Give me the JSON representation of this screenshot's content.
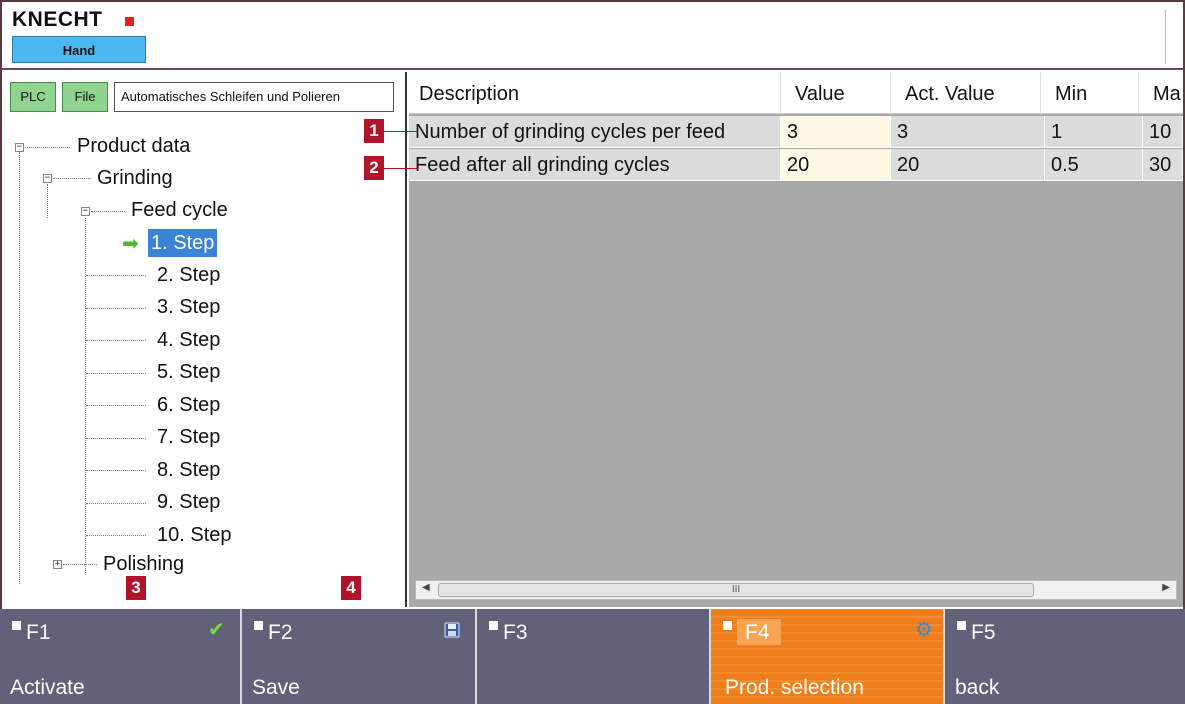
{
  "header": {
    "logo": "KNECHT",
    "mode": "Hand"
  },
  "toolbar": {
    "plc_label": "PLC",
    "file_label": "File",
    "program_name": "Automatisches Schleifen und Polieren"
  },
  "tree": {
    "root": "Product data",
    "grinding": "Grinding",
    "feed_cycle": "Feed cycle",
    "steps": [
      "1. Step",
      "2. Step",
      "3. Step",
      "4. Step",
      "5. Step",
      "6. Step",
      "7. Step",
      "8. Step",
      "9. Step",
      "10. Step"
    ],
    "polishing": "Polishing"
  },
  "grid": {
    "columns": [
      "Description",
      "Value",
      "Act. Value",
      "Min",
      "Ma"
    ],
    "rows": [
      {
        "description": "Number of grinding cycles per feed",
        "value": "3",
        "act_value": "3",
        "min": "1",
        "max": "10"
      },
      {
        "description": "Feed after all grinding cycles",
        "value": "20",
        "act_value": "20",
        "min": "0.5",
        "max": "30"
      }
    ],
    "scroll_grip": "III"
  },
  "callouts": [
    "1",
    "2",
    "3",
    "4"
  ],
  "function_keys": [
    {
      "key": "F1",
      "action": "Activate",
      "icon": "check-icon"
    },
    {
      "key": "F2",
      "action": "Save",
      "icon": "floppy-disk-icon"
    },
    {
      "key": "F3",
      "action": ""
    },
    {
      "key": "F4",
      "action": "Prod. selection",
      "icon": "gear-icon"
    },
    {
      "key": "F5",
      "action": "back"
    }
  ],
  "colors": {
    "highlight": "#ef7d1a",
    "selection": "#3b83d6",
    "callout": "#b3122b",
    "mode_box": "#4db8f0",
    "fbar": "#61617a"
  }
}
